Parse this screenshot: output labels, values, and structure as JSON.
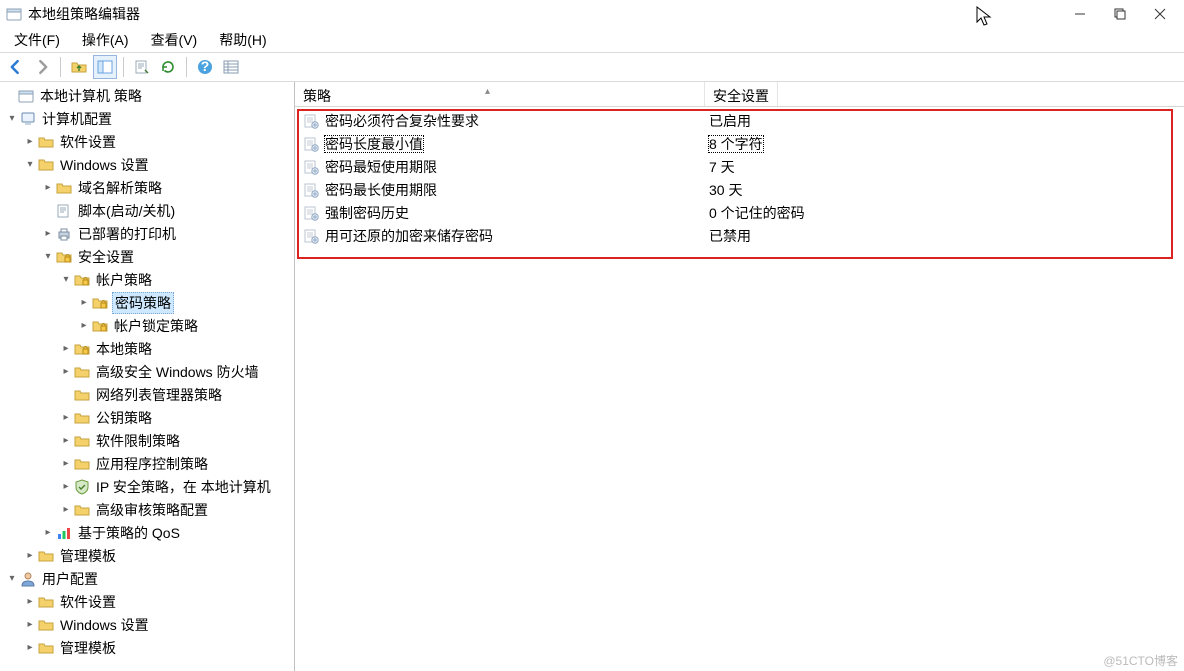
{
  "title": "本地组策略编辑器",
  "menu": [
    "文件(F)",
    "操作(A)",
    "查看(V)",
    "帮助(H)"
  ],
  "tree": {
    "root": "本地计算机 策略",
    "computer_config": "计算机配置",
    "software_settings": "软件设置",
    "windows_settings": "Windows 设置",
    "name_resolution": "域名解析策略",
    "scripts": "脚本(启动/关机)",
    "printers": "已部署的打印机",
    "security_settings": "安全设置",
    "account_policies": "帐户策略",
    "password_policy": "密码策略",
    "lockout_policy": "帐户锁定策略",
    "local_policies": "本地策略",
    "firewall": "高级安全 Windows 防火墙",
    "nlmgr": "网络列表管理器策略",
    "pubkey": "公钥策略",
    "software_restrict": "软件限制策略",
    "app_control": "应用程序控制策略",
    "ipsec": "IP 安全策略，在 本地计算机",
    "advaudit": "高级审核策略配置",
    "qos": "基于策略的 QoS",
    "admin_templates": "管理模板",
    "user_config": "用户配置",
    "u_software": "软件设置",
    "u_windows": "Windows 设置",
    "u_admin": "管理模板"
  },
  "columns": {
    "policy": "策略",
    "setting": "安全设置"
  },
  "policies": [
    {
      "name": "密码必须符合复杂性要求",
      "value": "已启用"
    },
    {
      "name": "密码长度最小值",
      "value": "8 个字符"
    },
    {
      "name": "密码最短使用期限",
      "value": "7 天"
    },
    {
      "name": "密码最长使用期限",
      "value": "30 天"
    },
    {
      "name": "强制密码历史",
      "value": "0 个记住的密码"
    },
    {
      "name": "用可还原的加密来储存密码",
      "value": "已禁用"
    }
  ],
  "watermark": "@51CTO博客"
}
